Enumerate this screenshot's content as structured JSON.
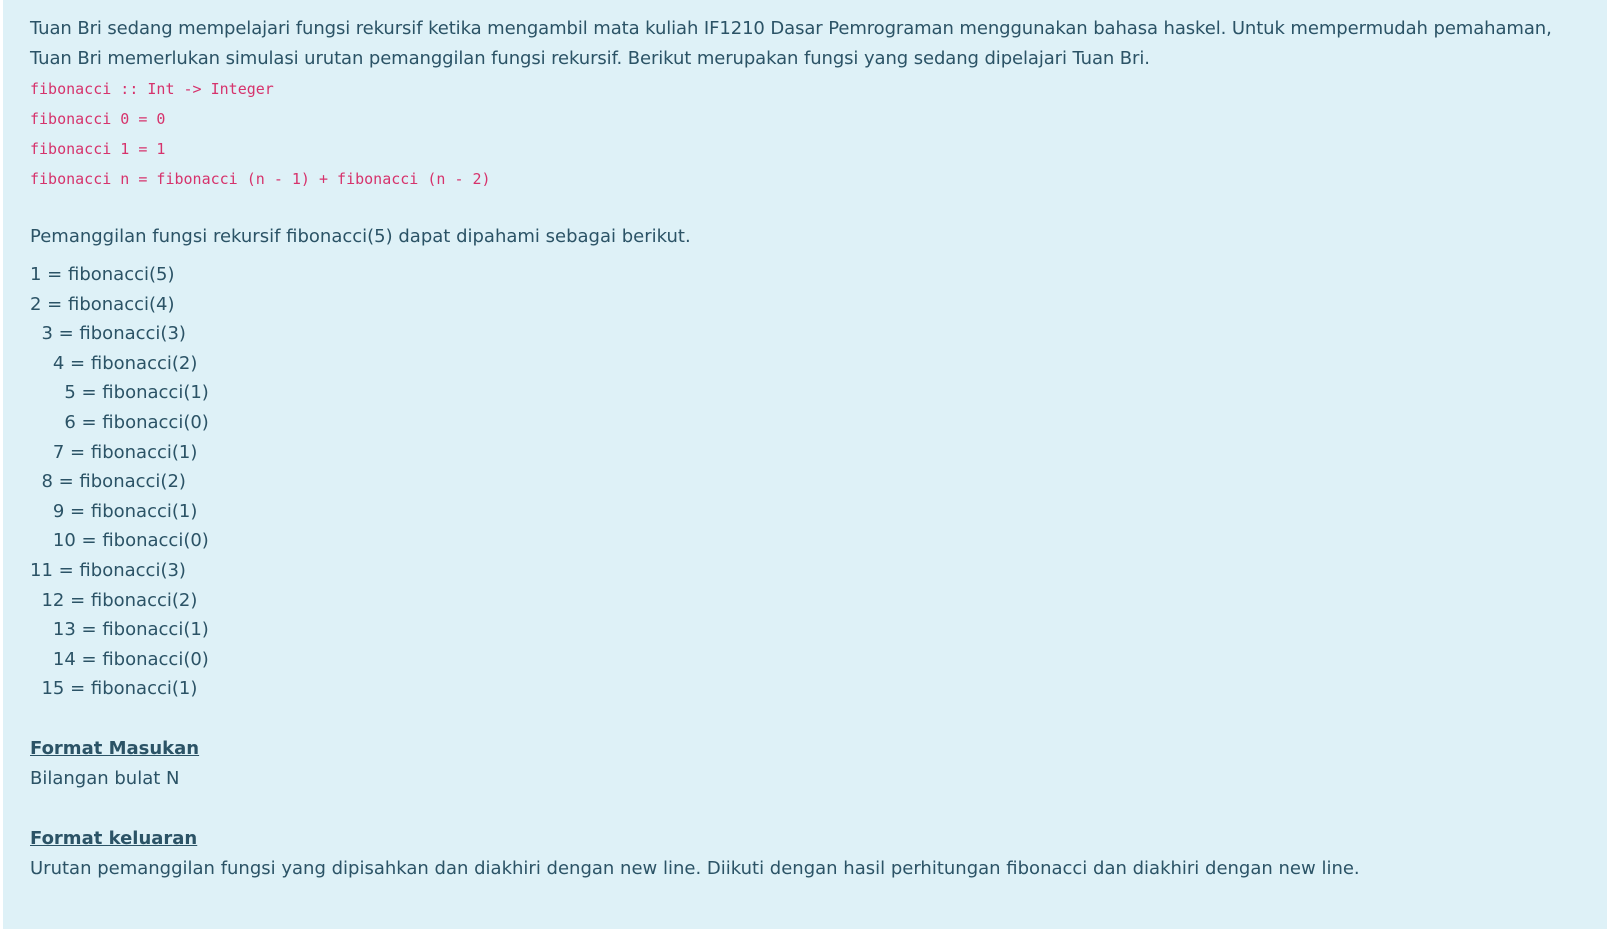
{
  "intro": "Tuan Bri sedang mempelajari fungsi rekursif ketika mengambil mata kuliah IF1210 Dasar Pemrograman menggunakan bahasa haskel. Untuk mempermudah pemahaman, Tuan Bri memerlukan simulasi urutan pemanggilan fungsi rekursif. Berikut merupakan fungsi yang sedang dipelajari Tuan Bri.",
  "code": [
    "fibonacci :: Int -> Integer",
    "fibonacci 0 = 0",
    "fibonacci 1 = 1",
    "fibonacci n = fibonacci (n - 1) + fibonacci (n - 2)"
  ],
  "calls_intro": "Pemanggilan fungsi rekursif fibonacci(5) dapat dipahami sebagai berikut.",
  "calls": [
    "1 = fibonacci(5)",
    "2 = fibonacci(4)",
    "  3 = fibonacci(3)",
    "    4 = fibonacci(2)",
    "      5 = fibonacci(1)",
    "      6 = fibonacci(0)",
    "    7 = fibonacci(1)",
    "  8 = fibonacci(2)",
    "    9 = fibonacci(1)",
    "    10 = fibonacci(0)",
    "11 = fibonacci(3)",
    "  12 = fibonacci(2)",
    "    13 = fibonacci(1)",
    "    14 = fibonacci(0)",
    "  15 = fibonacci(1)"
  ],
  "input_format": {
    "heading": "Format Masukan",
    "text": "Bilangan bulat N"
  },
  "output_format": {
    "heading": "Format keluaran",
    "text": "Urutan pemanggilan fungsi yang dipisahkan dan diakhiri dengan new line. Diikuti dengan hasil perhitungan fibonacci dan diakhiri dengan new line."
  },
  "colors": {
    "background": "#def1f7",
    "text": "#2b5366",
    "code": "#d6336c"
  }
}
